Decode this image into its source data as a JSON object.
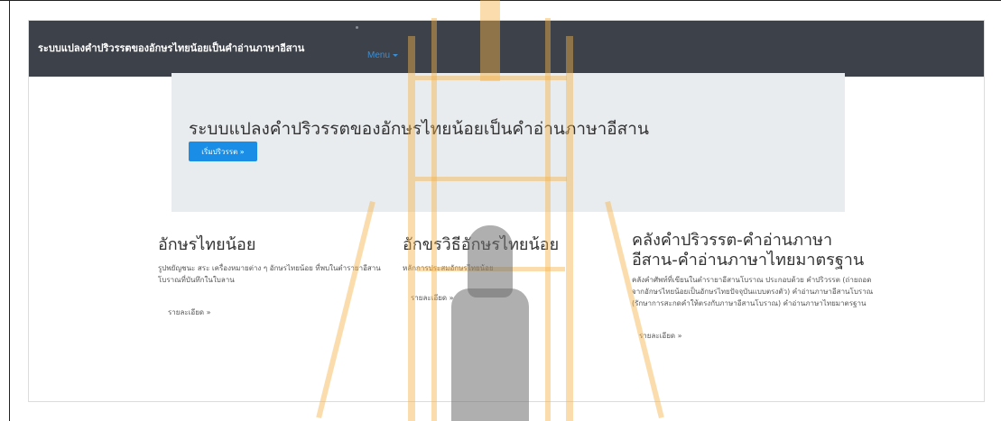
{
  "navbar": {
    "brand": "ระบบแปลงคำปริวรรตของอักษรไทยน้อยเป็นคำอ่านภาษาอีสาน",
    "menu_label": "Menu"
  },
  "jumbotron": {
    "title": "ระบบแปลงคำปริวรรตของอักษรไทยน้อยเป็นคำอ่านภาษาอีสาน",
    "button_label": "เริ่มปริวรรต »"
  },
  "columns": [
    {
      "heading": "อักษรไทยน้อย",
      "text": "รูปพยัญชนะ สระ เครื่องหมายต่าง ๆ อักษรไทยน้อย ที่พบในตำรายาอีสานโบราณที่บันทึกในใบลาน",
      "detail_label": "รายละเอียด »"
    },
    {
      "heading": "อักขรวิธีอักษรไทยน้อย",
      "text": "หลักการประสมอักษรไทยน้อย",
      "detail_label": "รายละเอียด »"
    },
    {
      "heading": "คลังคำปริวรรต-คำอ่านภาษาอีสาน-คำอ่านภาษาไทยมาตรฐาน",
      "text": "คลังคำศัพท์ที่เขียนในตำรายาอีสานโบราณ ประกอบด้วย คำปริวรรต (ถ่ายถอดจากอักษรไทยน้อยเป็นอักษรไทยปัจจุบันแบบตรงตัว) คำอ่านภาษาอีสานโบราณ (รักษาการสะกดคำให้ตรงกับภาษาอีสานโบราณ) คำอ่านภาษาไทยมาตรฐาน",
      "detail_label": "รายละเอียด »"
    }
  ],
  "colors": {
    "navbar_bg": "#3d4149",
    "jumbotron_bg": "#e9ecef",
    "primary_button": "#1a8ee6",
    "menu_link": "#3a8fd6",
    "watermark": "#f6b34a"
  },
  "icons": {
    "menu_caret": "caret-down-icon"
  }
}
